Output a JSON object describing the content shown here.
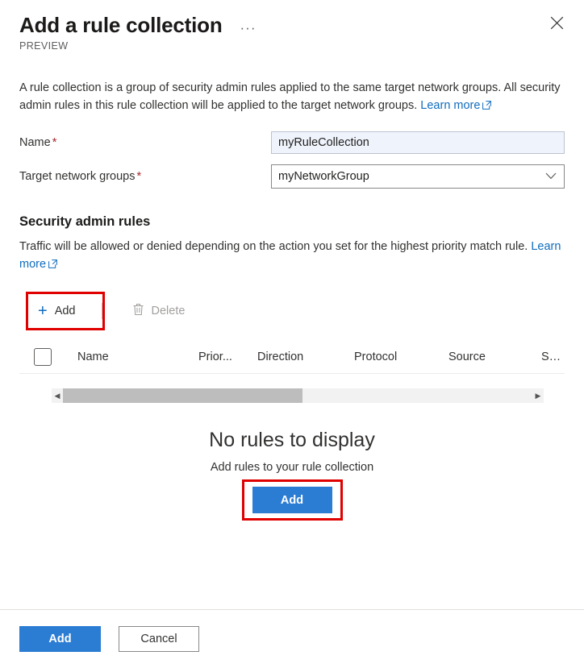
{
  "header": {
    "title": "Add a rule collection",
    "preview_label": "PREVIEW",
    "ellipsis_label": "···",
    "close_label": "Close"
  },
  "intro": {
    "text": "A rule collection is a group of security admin rules applied to the same target network groups. All security admin rules in this rule collection will be applied to the target network groups. ",
    "link_label": "Learn more"
  },
  "form": {
    "name": {
      "label": "Name",
      "required_mark": "*",
      "value": "myRuleCollection",
      "placeholder": ""
    },
    "target_network_groups": {
      "label": "Target network groups",
      "required_mark": "*",
      "value": "myNetworkGroup",
      "options": [
        "myNetworkGroup"
      ]
    }
  },
  "section": {
    "title": "Security admin rules",
    "description": "Traffic will be allowed or denied depending on the action you set for the highest priority match rule. ",
    "link_label": "Learn more"
  },
  "commandbar": {
    "add_label": "Add",
    "add_icon": "plus-icon",
    "delete_label": "Delete",
    "delete_icon": "trash-icon",
    "delete_disabled": true,
    "separator": "|"
  },
  "grid": {
    "columns": [
      "Name",
      "Prior...",
      "Direction",
      "Protocol",
      "Source",
      "S…"
    ],
    "rows": [],
    "scroll_left_arrow": "◀",
    "scroll_right_arrow": "▶"
  },
  "empty_state": {
    "title": "No rules to display",
    "subtitle": "Add rules to your rule collection",
    "button_label": "Add"
  },
  "footer": {
    "primary_label": "Add",
    "secondary_label": "Cancel"
  },
  "colors": {
    "accent_blue": "#2b7cd3",
    "link_blue": "#0f6cbd",
    "highlight_red": "#e00000",
    "required_red": "#a4262c",
    "input_focus_bg": "#eff3fc"
  }
}
